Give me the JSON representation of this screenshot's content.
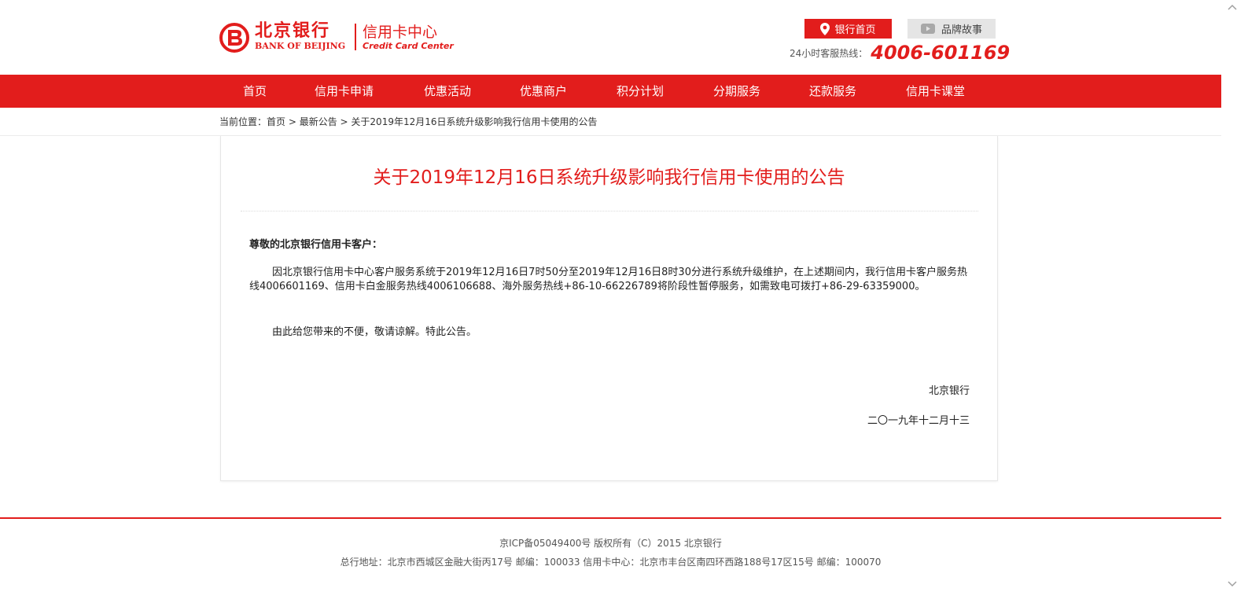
{
  "brand": {
    "name_cn": "北京银行",
    "name_en": "BANK OF BEIJING",
    "division_cn": "信用卡中心",
    "division_en": "Credit Card Center",
    "color": "#e21d1c"
  },
  "header": {
    "home_button": "银行首页",
    "brand_button": "品牌故事",
    "hotline_label": "24小时客服热线：",
    "hotline_number": "4006-601169"
  },
  "nav": {
    "items": [
      {
        "label": "首页"
      },
      {
        "label": "信用卡申请"
      },
      {
        "label": "优惠活动"
      },
      {
        "label": "优惠商户"
      },
      {
        "label": "积分计划"
      },
      {
        "label": "分期服务"
      },
      {
        "label": "还款服务"
      },
      {
        "label": "信用卡课堂"
      }
    ]
  },
  "breadcrumb": {
    "prefix": "当前位置：",
    "home": "首页",
    "sep": " > ",
    "section": "最新公告",
    "current": "关于2019年12月16日系统升级影响我行信用卡使用的公告"
  },
  "article": {
    "title": "关于2019年12月16日系统升级影响我行信用卡使用的公告",
    "greeting": "尊敬的北京银行信用卡客户：",
    "paragraph1": "因北京银行信用卡中心客户服务系统于2019年12月16日7时50分至2019年12月16日8时30分进行系统升级维护，在上述期间内，我行信用卡客户服务热线4006601169、信用卡白金服务热线4006106688、海外服务热线+86-10-66226789将阶段性暂停服务，如需致电可拨打+86-29-63359000。",
    "paragraph2": "由此给您带来的不便，敬请谅解。特此公告。",
    "signature_org": "北京银行",
    "signature_date": "二〇一九年十二月十三"
  },
  "footer": {
    "line1": "京ICP备05049400号  版权所有（C）2015  北京银行",
    "line2": "总行地址：北京市西城区金融大街丙17号  邮编：100033  信用卡中心：北京市丰台区南四环西路188号17区15号 邮编：100070"
  },
  "icons": {
    "home": "location-pin-icon",
    "brand": "play-icon"
  }
}
